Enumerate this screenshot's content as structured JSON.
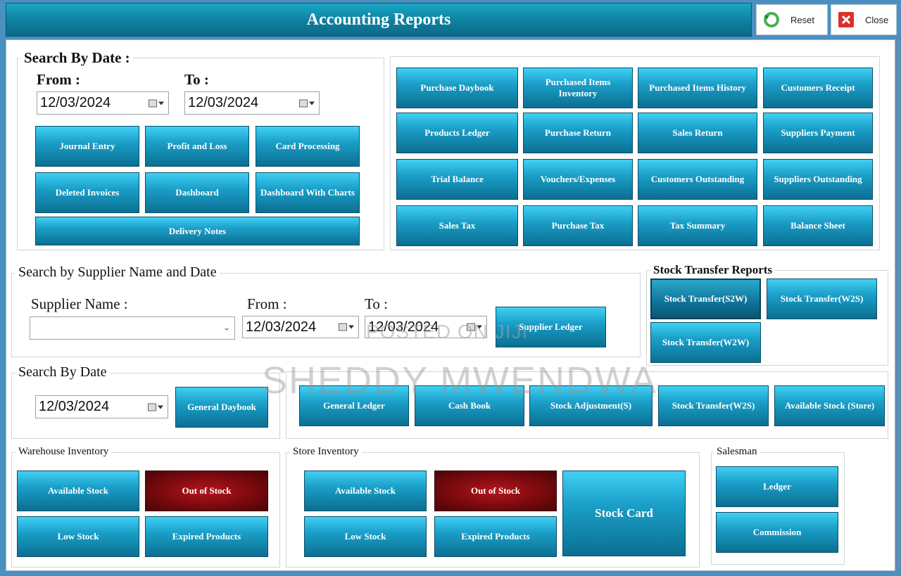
{
  "title": "Accounting Reports",
  "topbar": {
    "reset_label": "Reset",
    "close_label": "Close"
  },
  "search_by_date_top": {
    "legend": "Search By Date :",
    "from_label": "From :",
    "to_label": "To :",
    "from_value": "12/03/2024",
    "to_value": "12/03/2024",
    "buttons": [
      "Journal Entry",
      "Profit and Loss",
      "Card Processing",
      "Deleted Invoices",
      "Dashboard",
      "Dashboard With Charts",
      "Delivery Notes"
    ]
  },
  "reports_grid": {
    "buttons": [
      "Purchase Daybook",
      "Purchased Items Inventory",
      "Purchased Items History",
      "Customers Receipt",
      "Products Ledger",
      "Purchase Return",
      "Sales Return",
      "Suppliers Payment",
      "Trial Balance",
      "Vouchers/Expenses",
      "Customers Outstanding",
      "Suppliers Outstanding",
      "Sales Tax",
      "Purchase Tax",
      "Tax Summary",
      "Balance Sheet"
    ]
  },
  "supplier_search": {
    "legend": "Search by Supplier Name and Date",
    "supplier_label": "Supplier Name :",
    "supplier_value": "",
    "from_label": "From :",
    "to_label": "To :",
    "from_value": "12/03/2024",
    "to_value": "12/03/2024",
    "ledger_button": "Supplier Ledger"
  },
  "stock_transfer": {
    "legend": "Stock Transfer Reports",
    "buttons": [
      "Stock Transfer(S2W)",
      "Stock Transfer(W2S)",
      "Stock Transfer(W2W)"
    ]
  },
  "search_by_date_bottom": {
    "legend": "Search By Date",
    "date_value": "12/03/2024",
    "daybook_button": "General Daybook"
  },
  "ledger_row": {
    "buttons": [
      "General Ledger",
      "Cash Book",
      "Stock Adjustment(S)",
      "Stock Transfer(W2S)",
      "Available Stock (Store)"
    ]
  },
  "warehouse_inventory": {
    "legend": "Warehouse Inventory",
    "buttons": [
      "Available Stock",
      "Out of Stock",
      "Low Stock",
      "Expired Products"
    ]
  },
  "store_inventory": {
    "legend": "Store Inventory",
    "buttons": [
      "Available Stock",
      "Out of Stock",
      "Low Stock",
      "Expired Products",
      "Stock Card"
    ]
  },
  "salesman": {
    "legend": "Salesman",
    "buttons": [
      "Ledger",
      "Commission"
    ]
  },
  "watermarks": {
    "posted": "POSTED ON JIJI",
    "name": "SHEDDY MWENDWA"
  }
}
